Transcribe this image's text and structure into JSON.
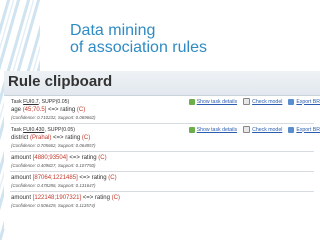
{
  "slide": {
    "title_line1": "Data mining",
    "title_line2": "of association rules"
  },
  "clipboard": {
    "title": "Rule clipboard",
    "actions": {
      "show_task_details": "Show task details",
      "check_model": "Check model",
      "export": "Export BR"
    },
    "tasks": [
      {
        "label_prefix": "Task ",
        "label_link": "FUI0.7",
        "label_suffix": ", SUPP(0.05)",
        "rules": [
          {
            "attribute": "age",
            "value": "(45;70.5]",
            "arrow": " <=> rating ",
            "consequent": "(C)",
            "measures": "(Confidence: 0.710232, Support: 0.069662)"
          }
        ]
      },
      {
        "label_prefix": "Task ",
        "label_link": "FUI0.430",
        "label_suffix": ", SUPP(0.05)",
        "rules": [
          {
            "attribute": "district",
            "value": "(Prahal)",
            "arrow": " <=> rating ",
            "consequent": "(C)",
            "measures": "(Confidence: 0.705662, Support: 0.064857)"
          },
          {
            "attribute": "amount",
            "value": "[4880;93504]",
            "arrow": " <=> rating ",
            "consequent": "(C)",
            "measures": "(Confidence: 0.409827, Support: 0.107750)"
          },
          {
            "attribute": "amount",
            "value": "[87064;1221485]",
            "arrow": " <=> rating ",
            "consequent": "(C)",
            "measures": "(Confidence: 0.478286, Support: 0.131647)"
          },
          {
            "attribute": "amount",
            "value": "[122148;1907321]",
            "arrow": " <=> rating ",
            "consequent": "(C)",
            "measures": "(Confidence: 0.506429, Support: 0.113574)"
          }
        ]
      }
    ]
  }
}
